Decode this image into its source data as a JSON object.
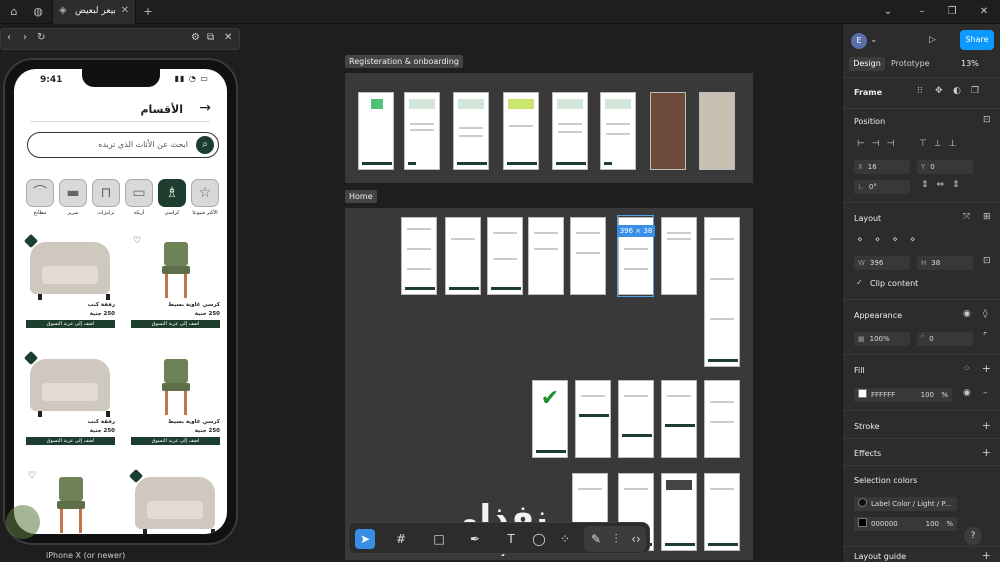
{
  "titlebar": {
    "tab_title": "بيعر لبعيض",
    "icons": [
      "home-icon",
      "globe-icon"
    ],
    "window_controls": [
      "chevron-down-icon",
      "minimize-icon",
      "restore-icon",
      "close-icon"
    ]
  },
  "preview": {
    "toolbar_icons": [
      "back-icon",
      "forward-icon",
      "refresh-icon",
      "settings-icon",
      "external-link-icon",
      "close-icon"
    ],
    "device_label": "iPhone X (or newer)",
    "app": {
      "time": "9:41",
      "page_title": "الأقسام",
      "search_placeholder": "ابحث عن الأثاث الذي تريده",
      "categories": [
        {
          "label": "الأكثر شيوعا",
          "icon": "star-icon",
          "selected": false
        },
        {
          "label": "كراسي",
          "icon": "chair-icon",
          "selected": true
        },
        {
          "label": "أريكة",
          "icon": "sofa-icon",
          "selected": false
        },
        {
          "label": "ترابيزات",
          "icon": "table-icon",
          "selected": false
        },
        {
          "label": "سرير",
          "icon": "bed-icon",
          "selected": false
        },
        {
          "label": "مطابخ",
          "icon": "lamp-icon",
          "selected": false
        }
      ],
      "products": [
        {
          "type": "sofa",
          "name": "رفقة كنب",
          "price": "250 جنية",
          "cta": "اضف إلى عربة التسوق",
          "favorite": true
        },
        {
          "type": "chair",
          "name": "كرسي غاوية بسيط",
          "price": "250 جنية",
          "cta": "اضف إلى عربة التسوق",
          "favorite": false
        },
        {
          "type": "sofa",
          "name": "رفقة كنب",
          "price": "250 جنية",
          "cta": "اضف إلى عربة التسوق",
          "favorite": true
        },
        {
          "type": "chair",
          "name": "كرسي غاوية بسيط",
          "price": "250 جنية",
          "cta": "اضف إلى عربة التسوق",
          "favorite": false
        },
        {
          "type": "chair",
          "name": "",
          "price": "",
          "cta": "",
          "favorite": false
        },
        {
          "type": "sofa",
          "name": "",
          "price": "",
          "cta": "",
          "favorite": false
        }
      ]
    }
  },
  "canvas": {
    "sections": [
      {
        "label": "Registeration & onboarding"
      },
      {
        "label": "Home"
      }
    ],
    "selection_badge": "396 × 38"
  },
  "toolbar": {
    "tools": [
      "move-tool-icon",
      "frame-tool-icon",
      "rectangle-tool-icon",
      "pen-tool-icon",
      "text-tool-icon",
      "comment-tool-icon",
      "components-icon"
    ],
    "dev_tools": [
      "draw-icon",
      "dev-mode-icon",
      "code-icon"
    ]
  },
  "watermark": {
    "arabic": "نفذلي",
    "latin": "nafezly.com"
  },
  "panel": {
    "avatar_letter": "E",
    "share_label": "Share",
    "tabs": [
      "Design",
      "Prototype"
    ],
    "zoom": "13%",
    "frame_label": "Frame",
    "position_title": "Position",
    "x_label": "X",
    "x_value": "16",
    "y_label": "Y",
    "y_value": "0",
    "rotation": "0°",
    "layout_title": "Layout",
    "w_label": "W",
    "w_value": "396",
    "h_label": "H",
    "h_value": "38",
    "clip_label": "Clip content",
    "appearance_title": "Appearance",
    "opacity": "100%",
    "radius": "0",
    "fill_title": "Fill",
    "fill_hex": "FFFFFF",
    "fill_opacity": "100",
    "fill_unit": "%",
    "stroke_title": "Stroke",
    "effects_title": "Effects",
    "selection_colors_title": "Selection colors",
    "color1_label": "Label Color / Light / P...",
    "color2_hex": "000000",
    "color2_opacity": "100",
    "color2_unit": "%",
    "layout_guide_title": "Layout guide",
    "help": "?"
  }
}
